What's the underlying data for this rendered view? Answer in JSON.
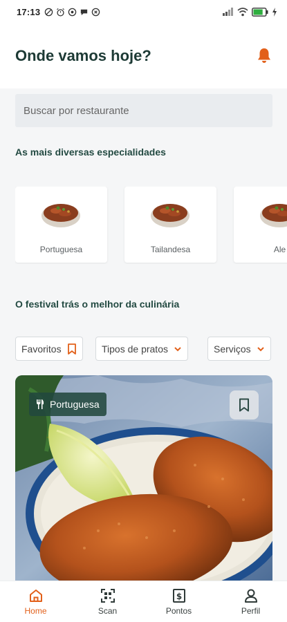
{
  "status_bar": {
    "time": "17:13",
    "icons": [
      "do-not-disturb-icon",
      "alarm-icon",
      "whatsapp-icon",
      "chat-icon",
      "shield-icon"
    ],
    "right_icons": [
      "signal-icon",
      "wifi-icon",
      "battery-icon",
      "charging-icon"
    ],
    "battery_level": 0.8
  },
  "header": {
    "title": "Onde vamos hoje?",
    "notification_icon": "bell-icon"
  },
  "search": {
    "placeholder": "Buscar por restaurante"
  },
  "specialties": {
    "title": "As mais diversas especialidades",
    "items": [
      {
        "label": "Portuguesa",
        "icon": "food-bowl"
      },
      {
        "label": "Tailandesa",
        "icon": "food-bowl"
      },
      {
        "label": "Ale",
        "icon": "food-bowl"
      }
    ]
  },
  "festival": {
    "title": "O festival trás o melhor da culinária"
  },
  "filters": [
    {
      "label": "Favoritos",
      "icon": "bookmark-icon"
    },
    {
      "label": "Tipos de pratos",
      "icon": "chevron-down-icon"
    },
    {
      "label": "Serviços",
      "icon": "chevron-down-icon"
    }
  ],
  "restaurant_card": {
    "cuisine_badge": "Portuguesa",
    "badge_icon": "fork-knife-icon",
    "save_icon": "bookmark-icon"
  },
  "bottom_nav": [
    {
      "label": "Home",
      "icon": "home-icon",
      "active": true
    },
    {
      "label": "Scan",
      "icon": "qr-scan-icon",
      "active": false
    },
    {
      "label": "Pontos",
      "icon": "points-icon",
      "active": false
    },
    {
      "label": "Perfil",
      "icon": "user-icon",
      "active": false
    }
  ],
  "colors": {
    "accent": "#e2601a",
    "text_dark": "#1d3a35",
    "badge_bg": "#22483e",
    "background": "#f5f6f7"
  }
}
